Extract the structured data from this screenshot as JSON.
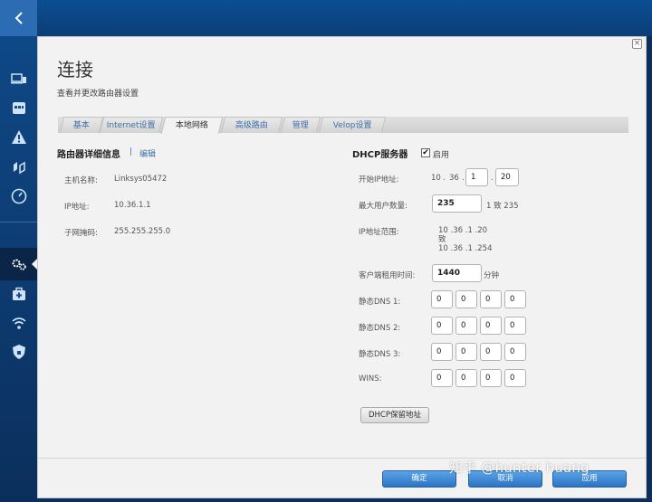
{
  "page": {
    "title": "连接",
    "subtitle": "查看并更改路由器设置"
  },
  "tabs": [
    {
      "label": "基本",
      "active": false
    },
    {
      "label": "Internet设置",
      "active": false
    },
    {
      "label": "本地网络",
      "active": true
    },
    {
      "label": "高级路由",
      "active": false
    },
    {
      "label": "管理",
      "active": false
    },
    {
      "label": "Velop设置",
      "active": false
    }
  ],
  "router_details": {
    "title": "路由器详细信息",
    "separator": "|",
    "edit_label": "编辑",
    "host_name_label": "主机名称:",
    "host_name_value": "Linksys05472",
    "ip_label": "IP地址:",
    "ip_value": "10.36.1.1",
    "subnet_label": "子网掩码:",
    "subnet_value": "255.255.255.0"
  },
  "dhcp": {
    "title": "DHCP服务器",
    "enabled_checked": "✔",
    "enabled_label": "启用",
    "start_ip_label": "开始IP地址:",
    "start_ip_oct1": "10",
    "start_ip_oct2": "36",
    "start_ip_oct3": "1",
    "start_ip_oct4": "20",
    "start_ip_dot": ".",
    "max_users_label": "最大用户数量:",
    "max_users_value": "235",
    "max_users_range": "1 致 235",
    "ip_range_label": "IP地址范围:",
    "ip_range_start": "10 .36 .1 .20",
    "ip_range_to": "致",
    "ip_range_end": "10 .36 .1 .254",
    "lease_label": "客户端租用时间:",
    "lease_value": "1440",
    "lease_unit": "分钟",
    "dns1_label": "静态DNS 1:",
    "dns1": [
      "0",
      "0",
      "0",
      "0"
    ],
    "dns2_label": "静态DNS 2:",
    "dns2": [
      "0",
      "0",
      "0",
      "0"
    ],
    "dns3_label": "静态DNS 3:",
    "dns3": [
      "0",
      "0",
      "0",
      "0"
    ],
    "wins_label": "WINS:",
    "wins": [
      "0",
      "0",
      "0",
      "0"
    ],
    "reservation_button": "DHCP保留地址"
  },
  "footer": {
    "ok_label": "确定",
    "cancel_label": "取消",
    "apply_label": "应用"
  },
  "watermark": "知乎 @hunter huang",
  "colors": {
    "sidebar": "#0f4a8a",
    "accent_link": "#3d6fa8",
    "button_blue": "#2c74c4",
    "panel_bg": "#f2f2f2"
  }
}
